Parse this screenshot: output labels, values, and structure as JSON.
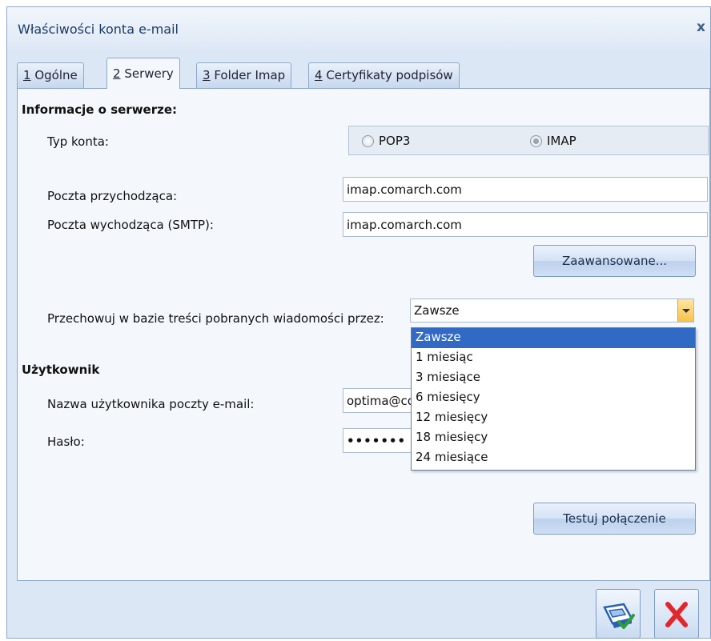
{
  "window": {
    "title": "Właściwości konta e-mail"
  },
  "tabs": [
    {
      "num": "1",
      "label": " Ogólne"
    },
    {
      "num": "2",
      "label": " Serwery"
    },
    {
      "num": "3",
      "label": " Folder Imap"
    },
    {
      "num": "4",
      "label": " Certyfikaty podpisów"
    }
  ],
  "server": {
    "header": "Informacje o serwerze:",
    "account_type_label": "Typ konta:",
    "pop3": "POP3",
    "imap": "IMAP",
    "incoming_label": "Poczta przychodząca:",
    "incoming_value": "imap.comarch.com",
    "outgoing_label": "Poczta wychodząca (SMTP):",
    "outgoing_value": "imap.comarch.com",
    "advanced_button": "Zaawansowane...",
    "keep_label": "Przechowuj w bazie treści pobranych wiadomości przez:",
    "keep_value": "Zawsze",
    "keep_options": [
      "Zawsze",
      "1 miesiąc",
      "3 miesiące",
      "6 miesięcy",
      "12 miesięcy",
      "18 miesięcy",
      "24 miesiące"
    ]
  },
  "user": {
    "header": "Użytkownik",
    "username_label": "Nazwa użytkownika poczty e-mail:",
    "username_value": "optima@co",
    "password_label": "Hasło:",
    "password_value": "•••••••",
    "test_button": "Testuj połączenie"
  },
  "icons": {
    "close": "close-icon",
    "save": "save-icon",
    "cancel": "cancel-icon"
  },
  "colors": {
    "selection": "#316ac5",
    "cancel_red": "#e3262b",
    "accent": "#f7c348"
  }
}
